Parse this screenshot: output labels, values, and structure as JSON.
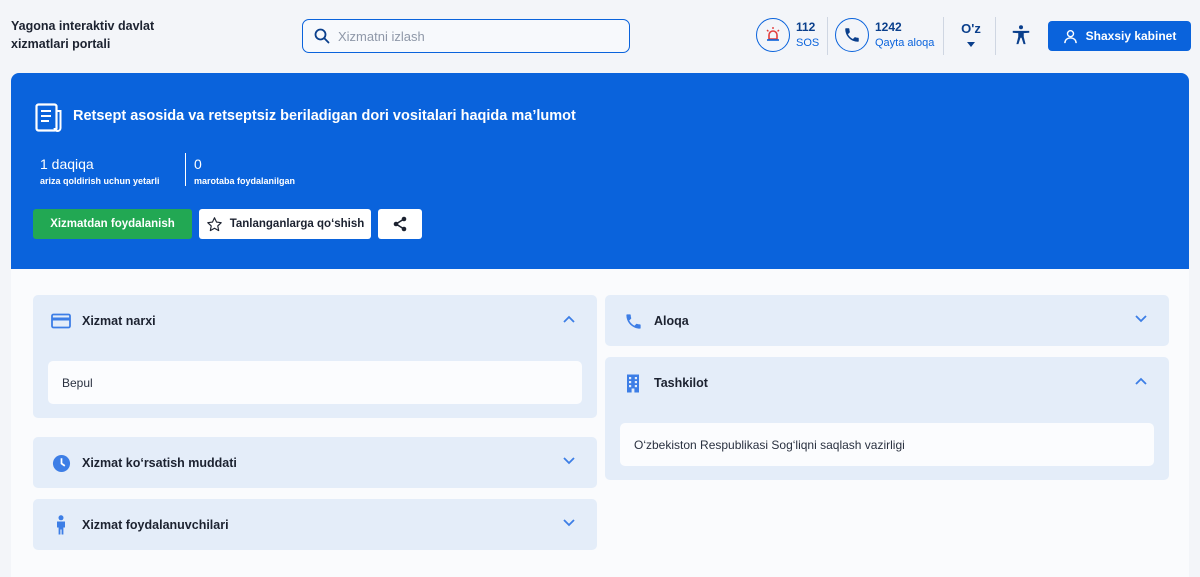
{
  "header": {
    "brand": "Yagona interaktiv davlat xizmatlari portali",
    "search_placeholder": "Xizmatni izlash",
    "sos_number": "112",
    "sos_label": "SOS",
    "callback_number": "1242",
    "callback_label": "Qayta aloqa",
    "language": "O'z",
    "cabinet_label": "Shaxsiy kabinet"
  },
  "hero": {
    "title": "Retsept asosida va retseptsiz beriladigan dori vositalari haqida ma’lumot",
    "stat1_value": "1 daqiqa",
    "stat1_label": "ariza qoldirish uchun yetarli",
    "stat2_value": "0",
    "stat2_label": "marotaba foydalanilgan",
    "use_button": "Xizmatdan foydalanish",
    "favorite_button": "Tanlanganlarga qo‘shish"
  },
  "cards": {
    "price_title": "Xizmat narxi",
    "price_value": "Bepul",
    "duration_title": "Xizmat ko‘rsatish muddati",
    "users_title": "Xizmat foydalanuvchilari",
    "contact_title": "Aloqa",
    "org_title": "Tashkilot",
    "org_value": "O‘zbekiston Respublikasi Sog‘liqni saqlash vazirligi"
  },
  "colors": {
    "primary": "#0a63dc",
    "success": "#22a853",
    "card_bg": "#e4edf9"
  }
}
